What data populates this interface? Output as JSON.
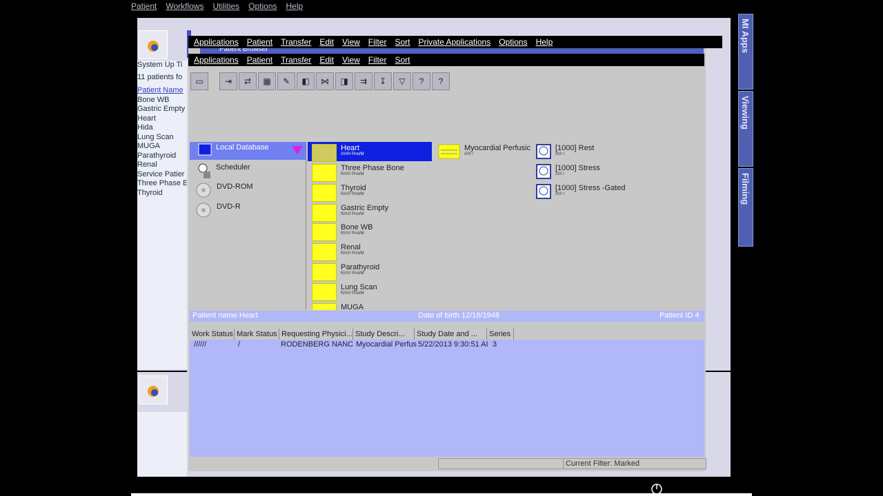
{
  "outer_menu": [
    "Patient",
    "Workflows",
    "Utilities",
    "Options",
    "Help"
  ],
  "left_panel": {
    "system_up": "System Up Ti",
    "patients_found": "11  patients fo",
    "header": "Patient Name",
    "patients": [
      "Bone WB",
      "Gastric Empty",
      "Heart",
      "Hida",
      "Lung Scan",
      "MUGA",
      "Parathyroid",
      "Renal",
      "Service Patier",
      "Three Phase E",
      "Thyroid"
    ]
  },
  "right_tabs": [
    "MI Apps",
    "Viewing",
    "Filming"
  ],
  "browser": {
    "title": "Patient Browser",
    "menu_main": [
      "Applications",
      "Patient",
      "Transfer",
      "Edit",
      "View",
      "Filter",
      "Sort",
      "Private Applications",
      "Options",
      "Help"
    ],
    "menu_sub": [
      "Applications",
      "Patient",
      "Transfer",
      "Edit",
      "View",
      "Filter",
      "Sort"
    ],
    "sources": [
      "Local Database",
      "Scheduler",
      "DVD-ROM",
      "DVD-R"
    ],
    "folders": [
      {
        "name": "Heart",
        "sub": "//////H Prot/M"
      },
      {
        "name": "Three Phase Bone",
        "sub": "R////// Prot/M"
      },
      {
        "name": "Thyroid",
        "sub": "R////// Prot/M"
      },
      {
        "name": "Gastric Empty",
        "sub": "R////// Prot/M"
      },
      {
        "name": "Bone WB",
        "sub": "R////// Prot/M"
      },
      {
        "name": "Renal",
        "sub": "R////// Prot/M"
      },
      {
        "name": "Parathyroid",
        "sub": "R////// Prot/M"
      },
      {
        "name": "Lung Scan",
        "sub": "R////// Prot/M"
      },
      {
        "name": "MUGA",
        "sub": ""
      }
    ],
    "study": {
      "name": "Myocardial Perfusic",
      "sub": "////// /"
    },
    "series": [
      {
        "name": "[1000] Rest",
        "sub": "////// /"
      },
      {
        "name": "[1000] Stress",
        "sub": "////// /"
      },
      {
        "name": "[1000] Stress -Gated",
        "sub": "////// /"
      }
    ],
    "patient_name": "Patient name Heart",
    "dob": "Date of birth 12/16/1948",
    "patient_id": "Patient ID 4",
    "columns": [
      "Work Status",
      "Mark Status",
      "Requesting Physici...",
      "Study Descri...",
      "Study Date and ...",
      "Series"
    ],
    "row": {
      "work_status": "//////",
      "mark_status": "/",
      "physician": "RODENBERG NANC",
      "description": "Myocardial Perfus",
      "date": "5/22/2013 9:30:51 AI",
      "series": "3"
    },
    "current_filter": "Current Filter: Marked"
  }
}
